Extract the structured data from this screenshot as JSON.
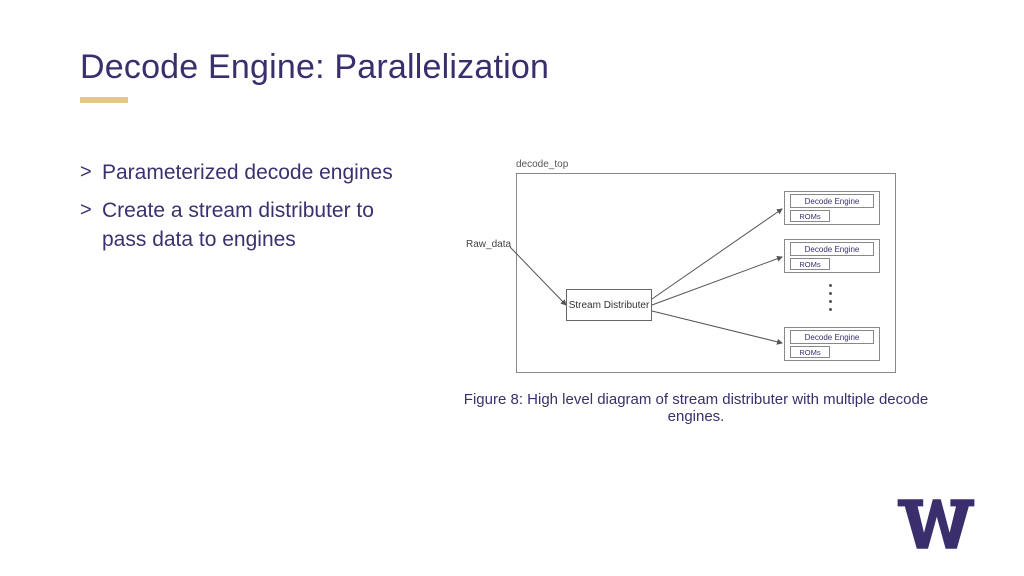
{
  "title": "Decode Engine: Parallelization",
  "bullets": [
    "Parameterized decode engines",
    "Create a stream distributer to pass data to engines"
  ],
  "diagram": {
    "container_label": "decode_top",
    "input_label": "Raw_data",
    "distributor_label": "Stream Distributer",
    "engine_label": "Decode Engine",
    "rom_label": "ROMs"
  },
  "caption": "Figure 8: High level diagram of stream distributer with multiple decode engines.",
  "colors": {
    "primary": "#3b2e6d",
    "accent": "#e3c985"
  }
}
